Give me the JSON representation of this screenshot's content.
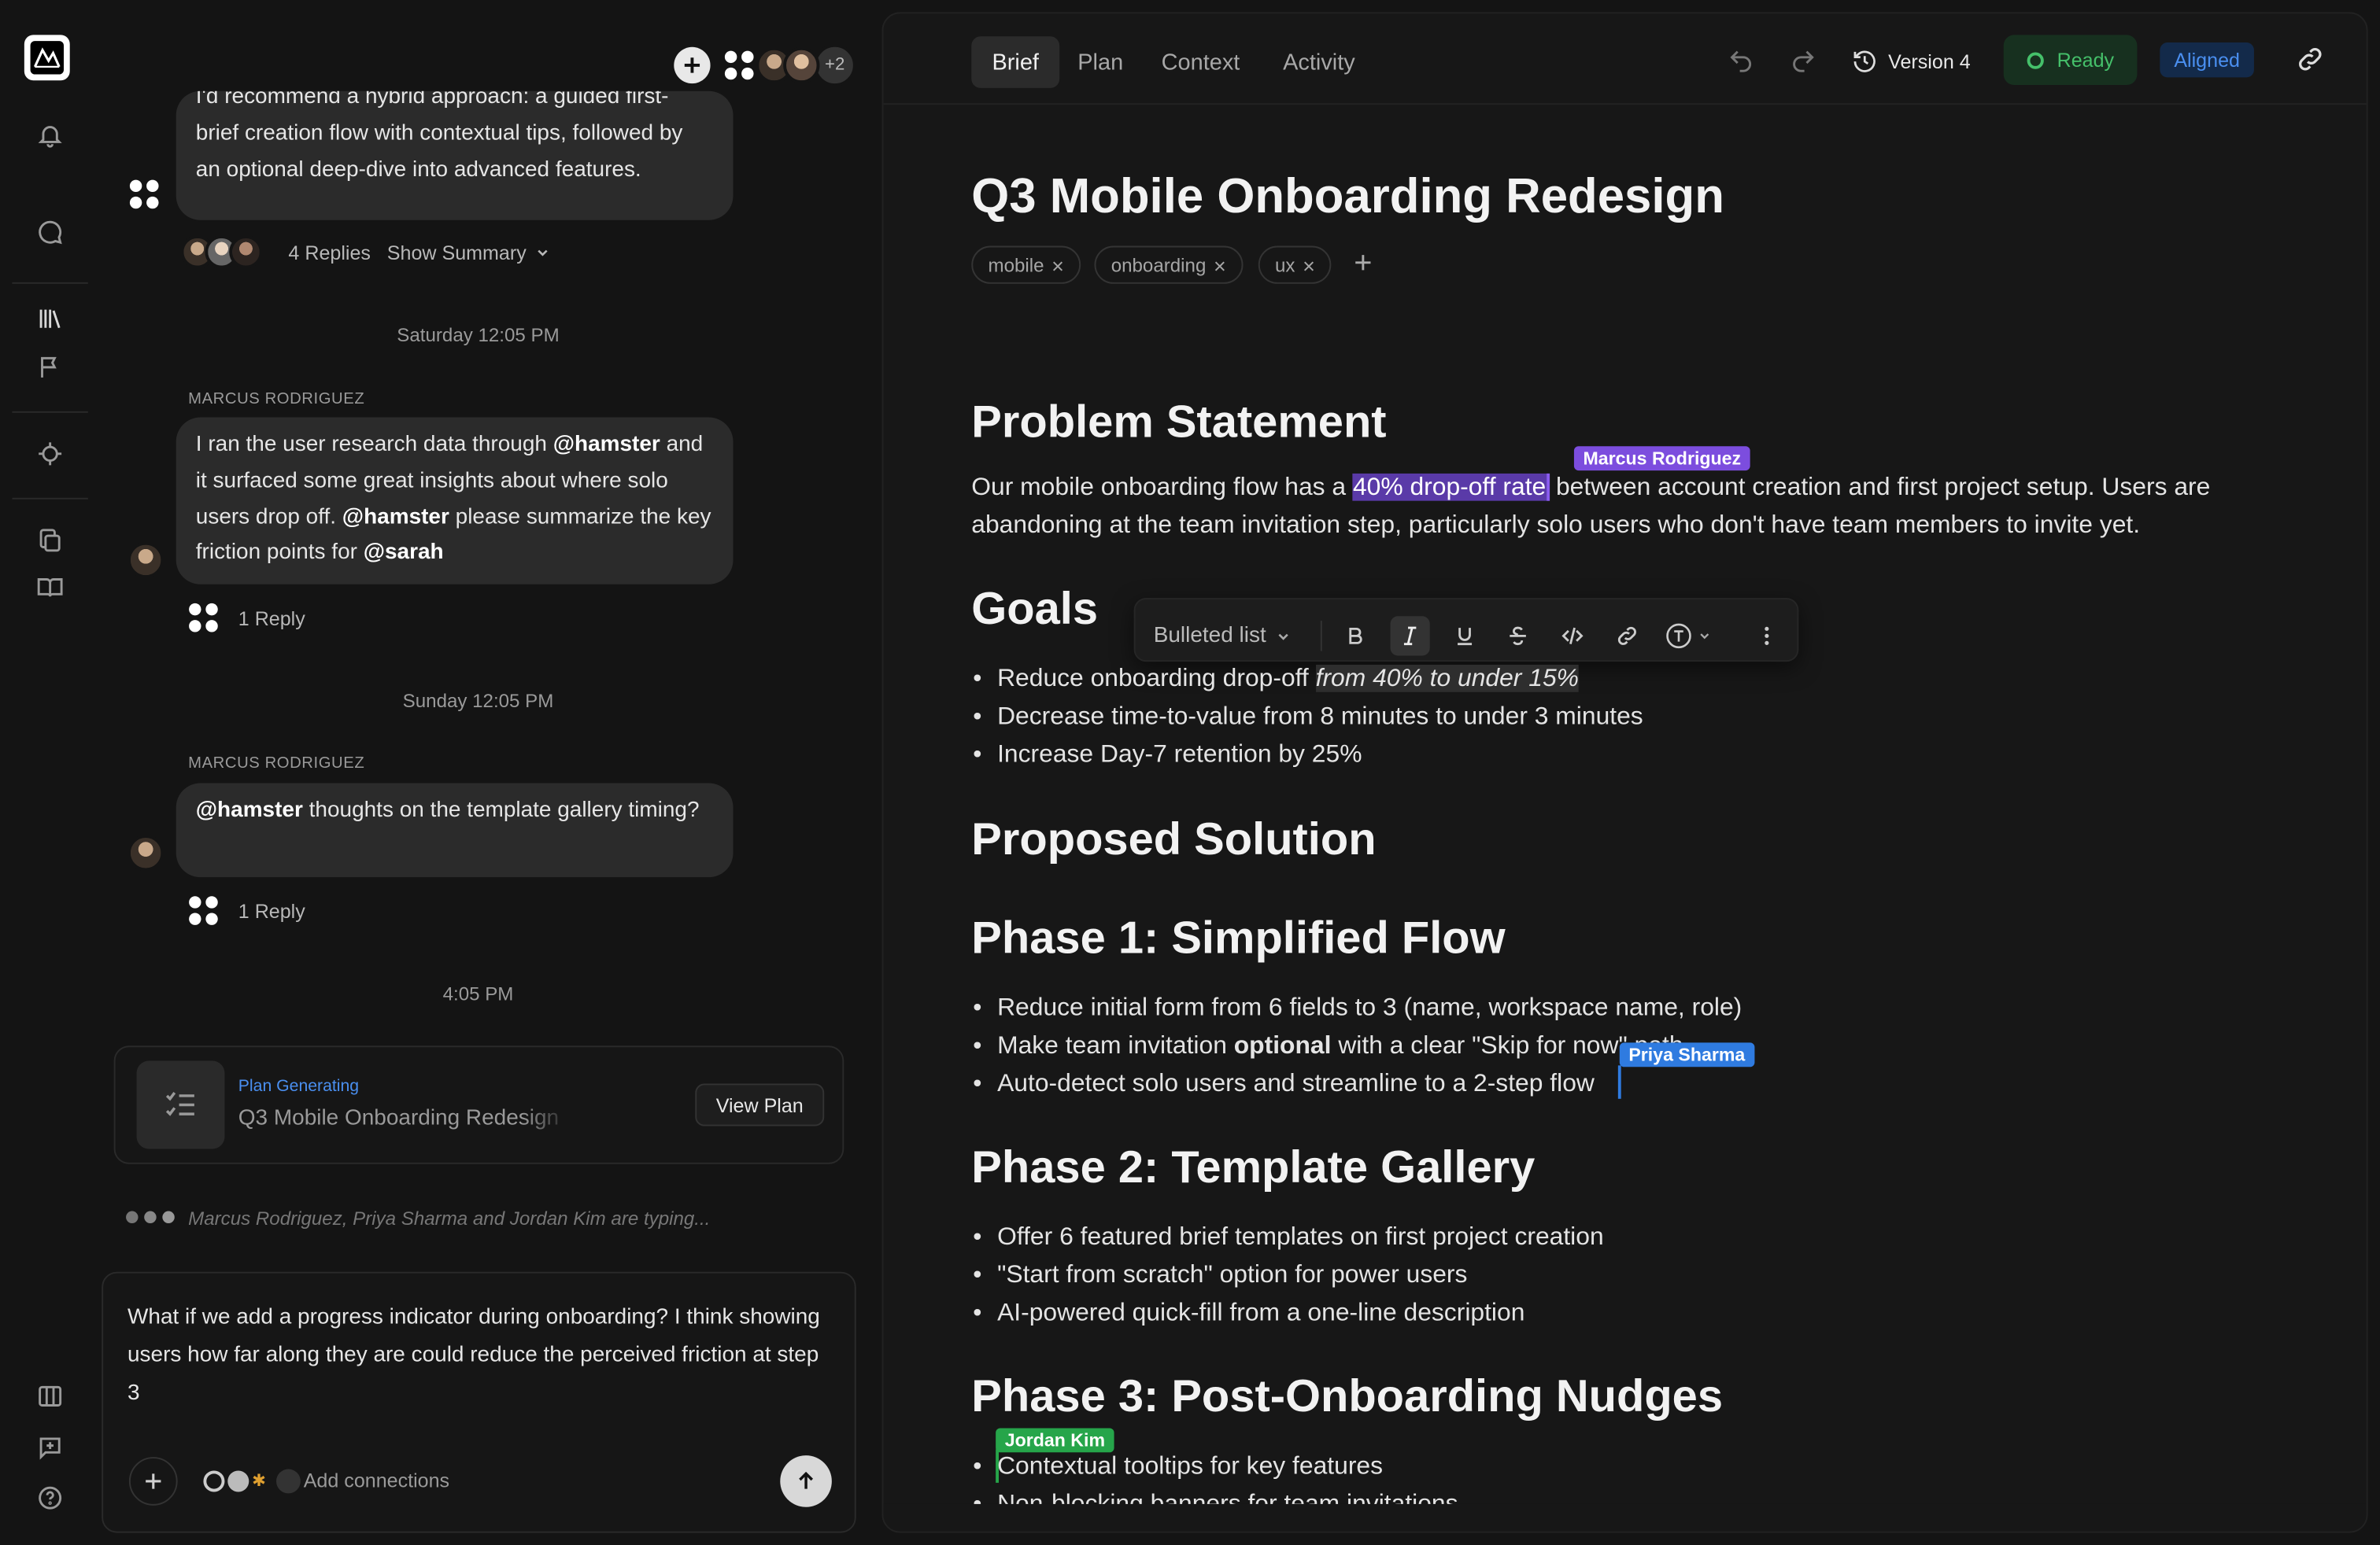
{
  "rail": {
    "logo": "app-logo",
    "icons": [
      "bell-icon",
      "chat-icon",
      "library-icon",
      "flag-icon",
      "target-icon",
      "copy-icon",
      "book-icon",
      "columns-icon",
      "feedback-icon",
      "help-icon"
    ]
  },
  "chat": {
    "header": {
      "more_count": "+2"
    },
    "messages": [
      {
        "text_lines": [
          "I'd recommend a hybrid approach: a guided first-",
          "brief creation flow with contextual tips, followed by",
          "an optional deep-dive into advanced features."
        ],
        "replies": "4 Replies",
        "summary": "Show Summary"
      },
      {
        "day": "Saturday 12:05 PM",
        "sender": "MARCUS RODRIGUEZ",
        "parts": [
          {
            "t": "I ran the user research data through "
          },
          {
            "b": "@hamster"
          },
          {
            "t": " and it surfaced some great insights about where solo users drop off. "
          },
          {
            "b": "@hamster"
          },
          {
            "t": " please summarize the key friction points for "
          },
          {
            "b": "@sarah"
          }
        ],
        "replies": "1 Reply"
      },
      {
        "day": "Sunday 12:05 PM",
        "sender": "MARCUS RODRIGUEZ",
        "parts": [
          {
            "b": "@hamster"
          },
          {
            "t": " thoughts on the template gallery timing?"
          }
        ],
        "replies": "1 Reply"
      }
    ],
    "time_415": "4:05 PM",
    "plan_card": {
      "status": "Plan Generating",
      "title": "Q3 Mobile Onboarding Redesign",
      "button": "View Plan"
    },
    "typing": "Marcus Rodriguez, Priya Sharma and Jordan Kim are typing...",
    "composer": {
      "text": "What if we add a progress indicator during onboarding? I think showing users how far along they are could reduce the perceived friction at step 3",
      "add_connections": "Add connections"
    }
  },
  "doc": {
    "tabs": [
      "Brief",
      "Plan",
      "Context",
      "Activity"
    ],
    "active_tab": "Brief",
    "version": "Version 4",
    "status": "Ready",
    "aligned": "Aligned",
    "title": "Q3 Mobile Onboarding Redesign",
    "tags": [
      "mobile",
      "onboarding",
      "ux"
    ],
    "problem": {
      "heading": "Problem Statement",
      "pre": "Our mobile onboarding flow has a ",
      "highlight": "40% drop-off rate",
      "post": " between account creation and first project setup. Users are abandoning at the team invitation step, particularly solo users who don't have team members to invite yet."
    },
    "goals": {
      "heading": "Goals",
      "items": [
        {
          "text": "Reduce onboarding drop-off ",
          "italic": "from 40% to under 15%"
        },
        {
          "text": "Decrease time-to-value from 8 minutes to under 3 minutes"
        },
        {
          "text": "Increase Day-7 retention by 25%"
        }
      ]
    },
    "toolbar": {
      "block_type": "Bulleted list"
    },
    "solution_heading": "Proposed Solution",
    "phase1": {
      "heading": "Phase 1: Simplified Flow",
      "items": [
        "Reduce initial form from 6 fields to 3 (name, workspace name, role)",
        {
          "pre": "Make team invitation ",
          "bold": "optional",
          "post": " with a clear \"Skip for now\" path"
        },
        "Auto-detect solo users and streamline to a 2-step flow"
      ]
    },
    "phase2": {
      "heading": "Phase 2: Template Gallery",
      "items": [
        "Offer 6 featured brief templates on first project creation",
        "\"Start from scratch\" option for power users",
        "AI-powered quick-fill from a one-line description"
      ]
    },
    "phase3": {
      "heading": "Phase 3: Post-Onboarding Nudges",
      "items": [
        "Contextual tooltips for key features",
        "Non-blocking banners for team invitations"
      ]
    },
    "cursors": [
      {
        "name": "Marcus Rodriguez",
        "color": "#7c4dde"
      },
      {
        "name": "Priya Sharma",
        "color": "#2f7be0"
      },
      {
        "name": "Jordan Kim",
        "color": "#26a54a"
      }
    ]
  }
}
